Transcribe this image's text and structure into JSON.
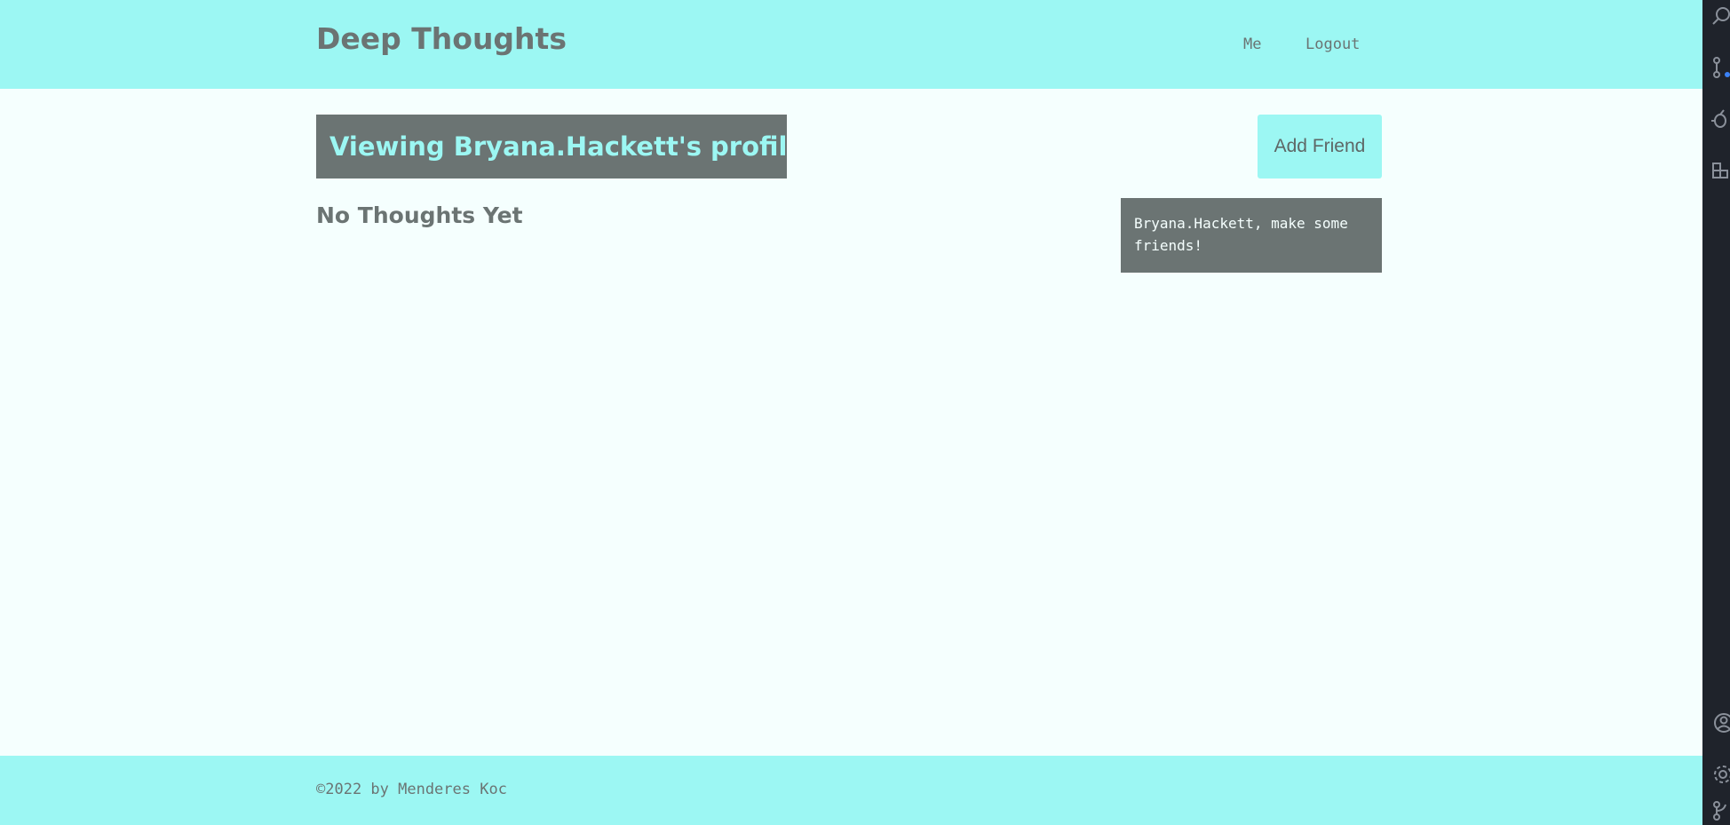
{
  "header": {
    "site_title": "Deep Thoughts",
    "nav": {
      "me_label": "Me",
      "logout_label": "Logout"
    }
  },
  "profile": {
    "banner": "Viewing Bryana.Hackett's profile.",
    "add_friend_label": "Add Friend",
    "no_thoughts": "No Thoughts Yet",
    "friends_message": "Bryana.Hackett, make some friends!"
  },
  "footer": {
    "text": "©2022 by Menderes Koc"
  },
  "side_strip": {
    "icons": [
      "search-icon",
      "source-control-icon",
      "debug-icon",
      "extensions-icon",
      "account-icon",
      "gear-icon",
      "remote-icon"
    ]
  },
  "colors": {
    "accent": "#9cf7f3",
    "dark": "#6b7473",
    "background": "#f5fffe",
    "editor_strip": "#1f232b"
  }
}
